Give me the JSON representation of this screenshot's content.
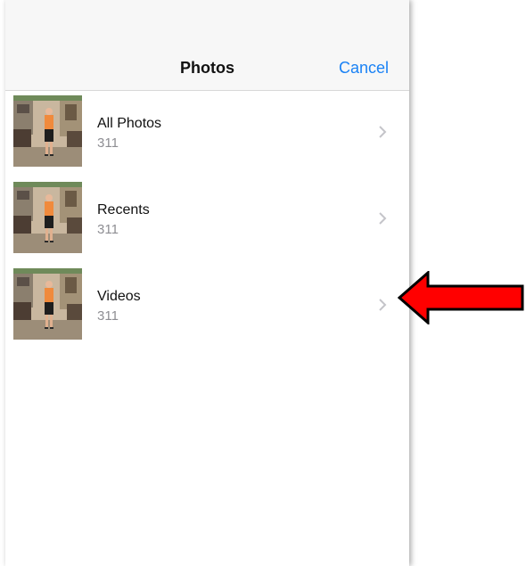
{
  "header": {
    "title": "Photos",
    "cancel_label": "Cancel"
  },
  "albums": [
    {
      "name": "All Photos",
      "count": "311"
    },
    {
      "name": "Recents",
      "count": "311"
    },
    {
      "name": "Videos",
      "count": "311"
    }
  ],
  "colors": {
    "accent": "#1a82f5",
    "annotation_arrow": "#ff0000"
  },
  "icons": {
    "row_disclosure": "chevron-right-icon",
    "annotation": "arrow-left-icon"
  }
}
